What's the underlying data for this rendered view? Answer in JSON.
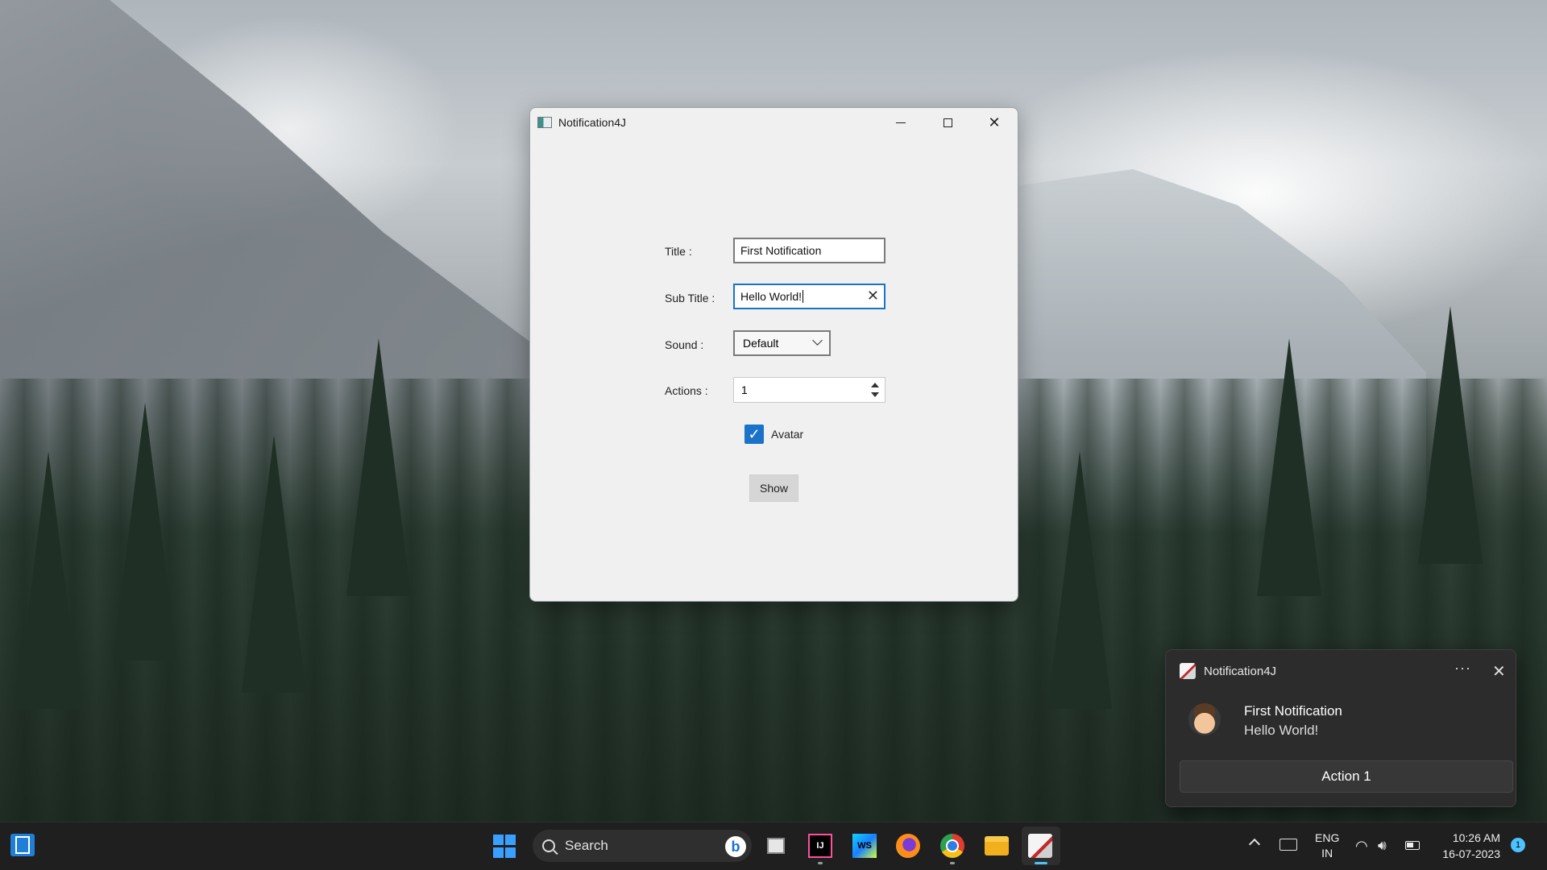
{
  "window": {
    "title": "Notification4J",
    "controls": {
      "minimize": "—",
      "maximize": "□",
      "close": "✕"
    }
  },
  "form": {
    "title_label": "Title :",
    "title_value": "First Notification",
    "subtitle_label": "Sub Title :",
    "subtitle_value": "Hello World!",
    "sound_label": "Sound :",
    "sound_value": "Default",
    "actions_label": "Actions :",
    "actions_value": "1",
    "avatar_label": "Avatar",
    "avatar_checked": true,
    "show_button": "Show"
  },
  "toast": {
    "app_name": "Notification4J",
    "more": "···",
    "close": "✕",
    "title": "First Notification",
    "body": "Hello World!",
    "action_label": "Action 1"
  },
  "taskbar": {
    "search_placeholder": "Search",
    "bing": "b",
    "ij_label": "IJ",
    "ws_label": "WS",
    "language_line1": "ENG",
    "language_line2": "IN",
    "time": "10:26 AM",
    "date": "16-07-2023",
    "notification_count": "1",
    "accent": "#4cc2ff"
  }
}
